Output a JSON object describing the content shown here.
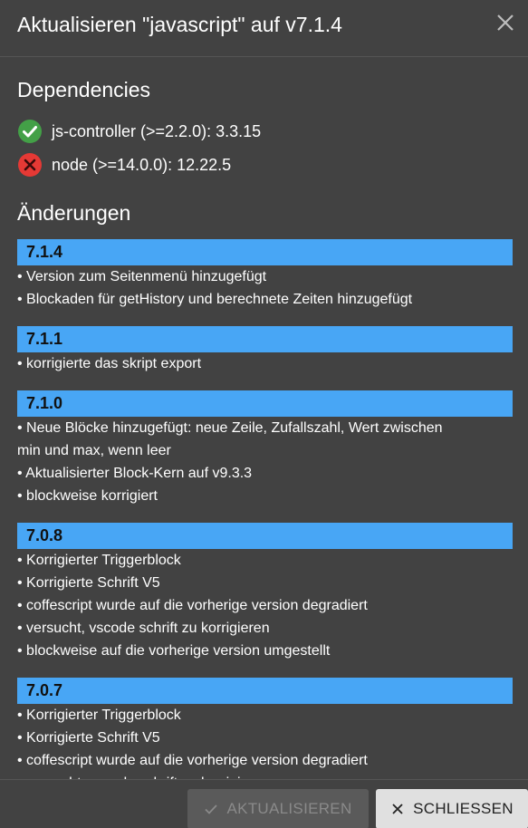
{
  "dialog": {
    "title": "Aktualisieren \"javascript\" auf v7.1.4"
  },
  "dependencies": {
    "heading": "Dependencies",
    "items": [
      {
        "label": "js-controller (>=2.2.0): 3.3.15",
        "status": "ok",
        "icon": "check-circle-icon",
        "color": "#43a047"
      },
      {
        "label": "node (>=14.0.0): 12.22.5",
        "status": "error",
        "icon": "error-circle-icon",
        "color": "#e53935"
      }
    ]
  },
  "changes": {
    "heading": "Änderungen",
    "versions": [
      {
        "version": "7.1.4",
        "lines": [
          "• Version zum Seitenmenü hinzugefügt",
          "• Blockaden für getHistory und berechnete Zeiten hinzugefügt"
        ]
      },
      {
        "version": "7.1.1",
        "lines": [
          "• korrigierte das skript export"
        ]
      },
      {
        "version": "7.1.0",
        "lines": [
          "• Neue Blöcke hinzugefügt: neue Zeile, Zufallszahl, Wert zwischen",
          "min und max, wenn leer",
          "• Aktualisierter Block-Kern auf v9.3.3",
          "• blockweise korrigiert"
        ]
      },
      {
        "version": "7.0.8",
        "lines": [
          "• Korrigierter Triggerblock",
          "• Korrigierte Schrift V5",
          "• coffescript wurde auf die vorherige version degradiert",
          "• versucht, vscode schrift zu korrigieren",
          "• blockweise auf die vorherige version umgestellt"
        ]
      },
      {
        "version": "7.0.7",
        "lines": [
          "• Korrigierter Triggerblock",
          "• Korrigierte Schrift V5",
          "• coffescript wurde auf die vorherige version degradiert",
          "• versucht, vscode schrift zu korrigieren"
        ]
      }
    ]
  },
  "footer": {
    "update_label": "AKTUALISIEREN",
    "close_label": "SCHLIESSEN"
  },
  "colors": {
    "background": "#424242",
    "version_bar": "#48a6f5",
    "ok": "#43a047",
    "error": "#e53935"
  }
}
